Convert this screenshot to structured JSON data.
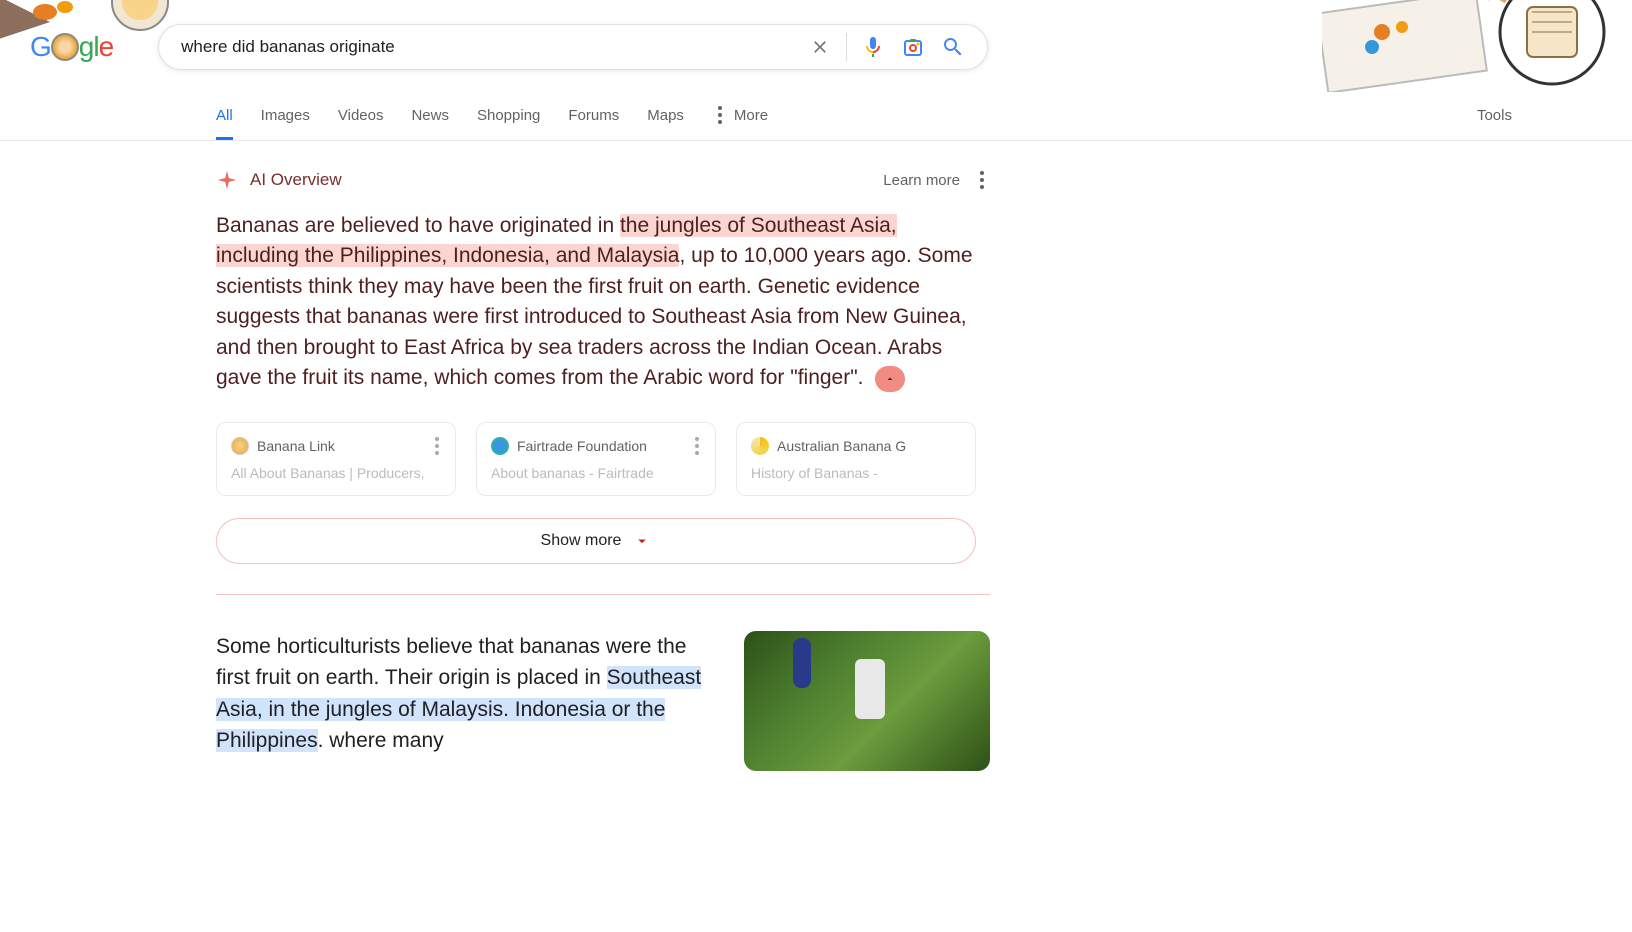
{
  "search": {
    "query": "where did bananas originate"
  },
  "tabs": {
    "all": "All",
    "images": "Images",
    "videos": "Videos",
    "news": "News",
    "shopping": "Shopping",
    "forums": "Forums",
    "maps": "Maps",
    "more": "More",
    "tools": "Tools"
  },
  "ai_overview": {
    "label": "AI Overview",
    "learn_more": "Learn more",
    "text_pre": "Bananas are believed to have originated in ",
    "text_hl": "the jungles of Southeast Asia, including the Philippines, Indonesia, and Malaysia",
    "text_post": ", up to 10,000 years ago. Some scientists think they may have been the first fruit on earth. Genetic evidence suggests that bananas were first introduced to Southeast Asia from New Guinea, and then brought to East Africa by sea traders across the Indian Ocean. Arabs gave the fruit its name, which comes from the Arabic word for \"finger\". "
  },
  "sources": [
    {
      "name": "Banana Link",
      "subtitle": "All About Bananas | Producers,"
    },
    {
      "name": "Fairtrade Foundation",
      "subtitle": "About bananas - Fairtrade"
    },
    {
      "name": "Australian Banana G",
      "subtitle": "History of Bananas -"
    }
  ],
  "show_more": "Show more",
  "featured": {
    "pre": "Some horticulturists believe that bananas were the first fruit on earth. Their origin is placed in ",
    "hl": "Southeast Asia, in the jungles of Malaysis. Indonesia or the Philippines",
    "post": ". where many"
  }
}
